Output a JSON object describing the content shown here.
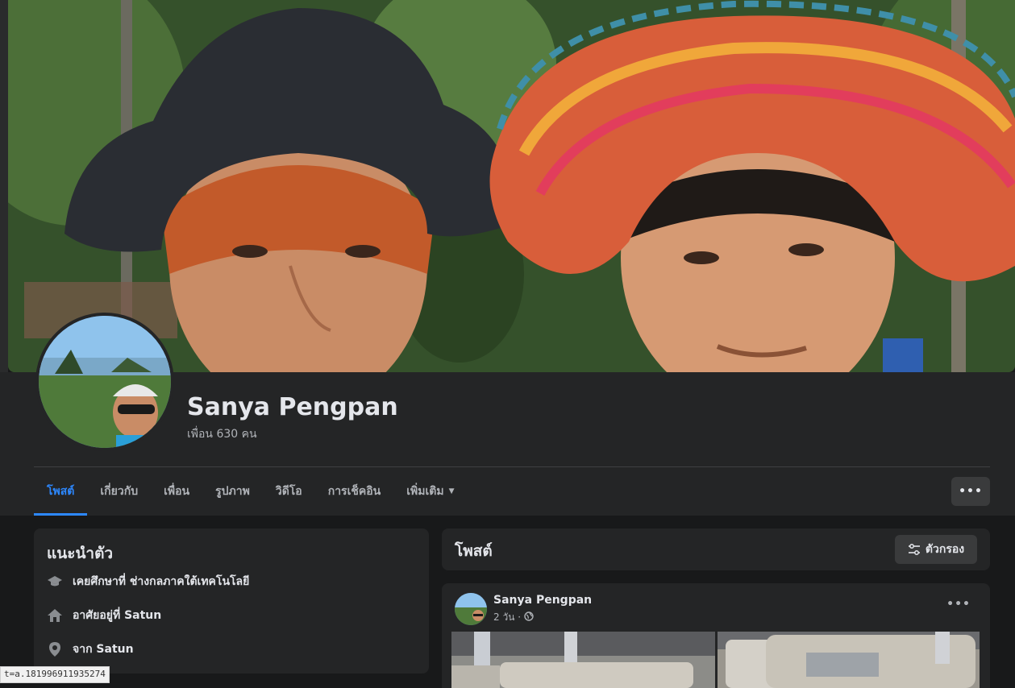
{
  "profile": {
    "name": "Sanya Pengpan",
    "friends_text": "เพื่อน 630 คน"
  },
  "tabs": [
    {
      "label": "โพสต์",
      "active": true
    },
    {
      "label": "เกี่ยวกับ"
    },
    {
      "label": "เพื่อน"
    },
    {
      "label": "รูปภาพ"
    },
    {
      "label": "วิดีโอ"
    },
    {
      "label": "การเช็คอิน"
    },
    {
      "label": "เพิ่มเติม"
    }
  ],
  "more_menu_label": "•••",
  "intro": {
    "title": "แนะนำตัว",
    "items": [
      {
        "icon": "graduation-cap-icon",
        "text": "เคยศึกษาที่ ช่างกลภาคใต้เทคโนโลยี"
      },
      {
        "icon": "home-icon",
        "text": "อาศัยอยู่ที่ Satun"
      },
      {
        "icon": "location-pin-icon",
        "text": "จาก Satun"
      }
    ]
  },
  "posts": {
    "title": "โพสต์",
    "filter_label": "ตัวกรอง",
    "first_post": {
      "author": "Sanya Pengpan",
      "time": "2 วัน ·",
      "privacy_icon": "globe-icon",
      "menu_label": "•••"
    }
  },
  "status_bar_url": "t=a.181996911935274",
  "colors": {
    "accent": "#2d88ff",
    "background": "#18191a",
    "card": "#242526",
    "button": "#3a3b3c"
  }
}
